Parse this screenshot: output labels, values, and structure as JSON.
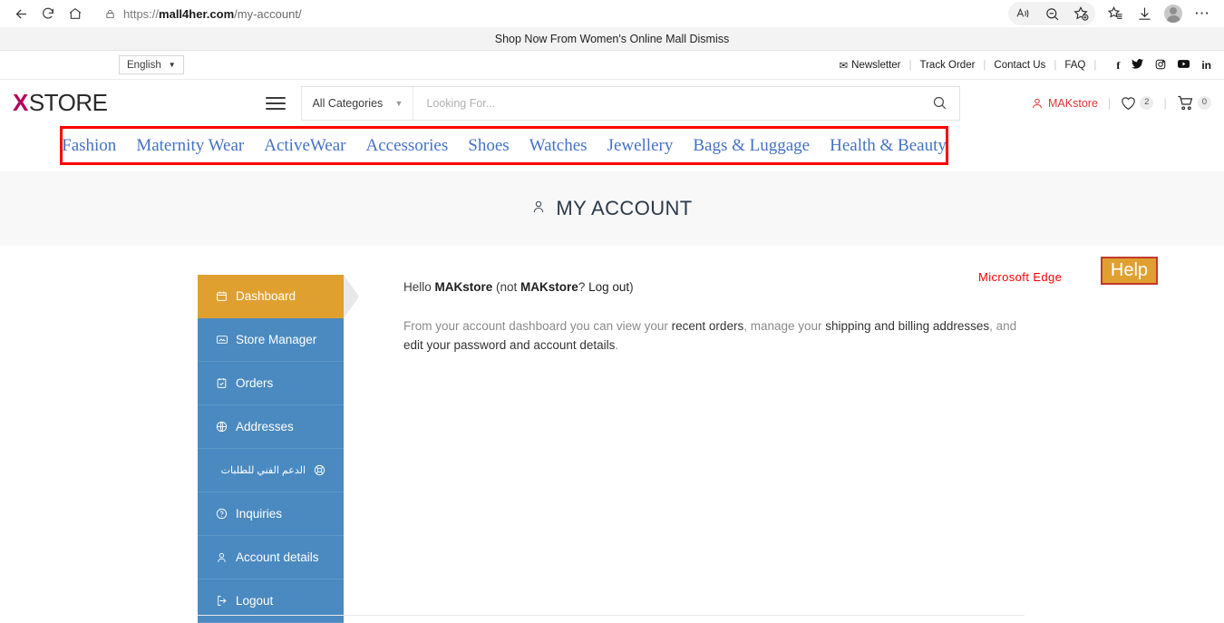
{
  "browser": {
    "url_protocol": "https://",
    "url_domain": "mall4her.com",
    "url_path": "/my-account/",
    "back_icon": "back-arrow-icon",
    "refresh_icon": "refresh-icon",
    "home_icon": "home-icon",
    "lock_icon": "lock-icon",
    "read_aloud_icon": "read-aloud-icon",
    "zoom_out_icon": "zoom-out-icon",
    "add_favorite_icon": "add-to-favorites-icon",
    "favorites_icon": "favorites-list-icon",
    "downloads_icon": "downloads-icon",
    "profile_icon": "profile-avatar-icon",
    "more_icon": "more-options-icon"
  },
  "notice": {
    "text": "Shop Now From Women's Online Mall Dismiss"
  },
  "topbar": {
    "language": "English",
    "links": [
      {
        "label": "Newsletter",
        "icon": "envelope-icon"
      },
      {
        "label": "Track Order"
      },
      {
        "label": "Contact Us"
      },
      {
        "label": "FAQ"
      }
    ],
    "social": [
      {
        "name": "facebook-icon",
        "glyph": "f"
      },
      {
        "name": "twitter-icon",
        "glyph": "🐦"
      },
      {
        "name": "instagram-icon",
        "glyph": "◎"
      },
      {
        "name": "youtube-icon",
        "glyph": "▶"
      },
      {
        "name": "linkedin-icon",
        "glyph": "in"
      }
    ]
  },
  "header": {
    "logo_x": "X",
    "logo_text": "STORE",
    "category_label": "All Categories",
    "search_placeholder": "Looking For...",
    "search_value": "",
    "account_name": "MAKstore",
    "wishlist_count": "2",
    "cart_count": "0"
  },
  "nav": {
    "items": [
      {
        "label": "Fashion"
      },
      {
        "label": "Maternity Wear"
      },
      {
        "label": "ActiveWear"
      },
      {
        "label": "Accessories"
      },
      {
        "label": "Shoes"
      },
      {
        "label": "Watches"
      },
      {
        "label": "Jewellery"
      },
      {
        "label": "Bags & Luggage"
      },
      {
        "label": "Health & Beauty"
      }
    ],
    "highlight_color": "#ff0000",
    "link_color": "#4472c4"
  },
  "annotation": {
    "edge_label": "Microsoft Edge",
    "help_label": "Help",
    "help_bg": "#e0a030",
    "help_border": "#c0392b"
  },
  "page": {
    "title": "MY ACCOUNT",
    "title_icon": "person-icon"
  },
  "sidebar": {
    "items": [
      {
        "label": "Dashboard",
        "icon": "calendar-icon",
        "active": true
      },
      {
        "label": "Store Manager",
        "icon": "monitor-icon",
        "active": false
      },
      {
        "label": "Orders",
        "icon": "checklist-icon",
        "active": false
      },
      {
        "label": "Addresses",
        "icon": "globe-icon",
        "active": false
      },
      {
        "label": "الدعم الفني للطلبات",
        "icon": "lifebuoy-icon",
        "active": false,
        "rtl": true
      },
      {
        "label": "Inquiries",
        "icon": "question-circle-icon",
        "active": false
      },
      {
        "label": "Account details",
        "icon": "person-icon",
        "active": false
      },
      {
        "label": "Logout",
        "icon": "logout-icon",
        "active": false
      }
    ],
    "active_bg": "#e0a030",
    "bg": "#4a8ac0"
  },
  "main": {
    "greeting_prefix": "Hello ",
    "greeting_name": "MAKstore",
    "greeting_mid": " (not ",
    "greeting_name2": "MAKstore",
    "greeting_q": "? ",
    "logout_link": "Log out",
    "greeting_suffix": ")",
    "desc_p1": "From your account dashboard you can view your ",
    "desc_link1": "recent orders",
    "desc_p2": ", manage your ",
    "desc_link2": "shipping and billing addresses",
    "desc_p3": ", and ",
    "desc_link3": "edit your password and account details",
    "desc_p4": "."
  }
}
